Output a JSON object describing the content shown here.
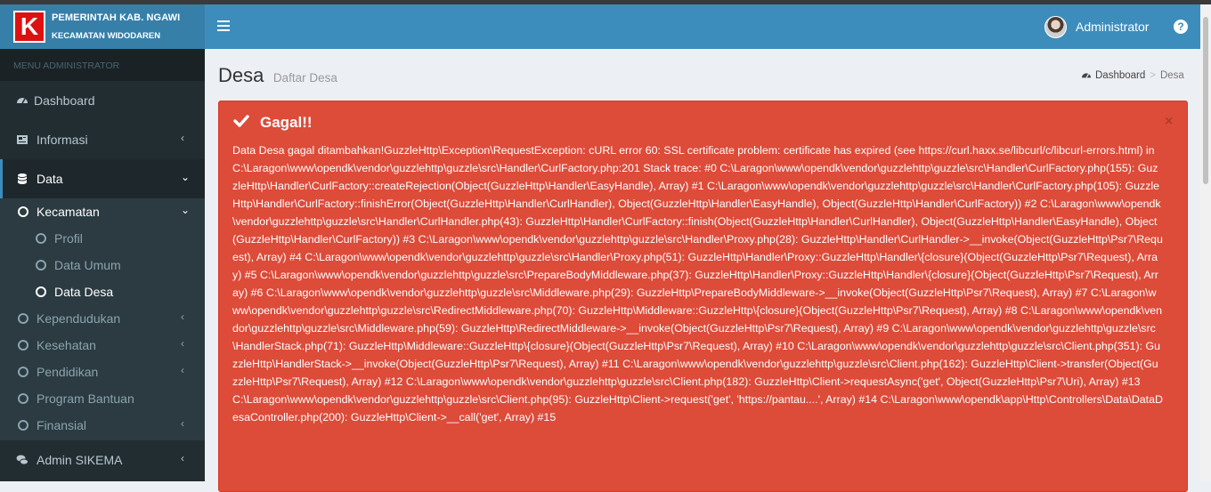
{
  "app": {
    "logo_letter": "K",
    "org_line1": "PEMERINTAH KAB. NGAWI",
    "org_line2": "KECAMATAN WIDODAREN"
  },
  "navbar": {
    "user_name": "Administrator",
    "help_icon": "question-circle-icon",
    "menu_icon": "hamburger-icon"
  },
  "sidebar": {
    "header": "MENU ADMINISTRATOR",
    "items": [
      {
        "label": "Dashboard",
        "icon": "dashboard-icon"
      },
      {
        "label": "Informasi",
        "icon": "newspaper-icon"
      },
      {
        "label": "Data",
        "icon": "database-icon"
      },
      {
        "label": "Admin SIKEMA",
        "icon": "comments-icon"
      }
    ],
    "data_submenu": [
      {
        "label": "Kecamatan"
      },
      {
        "label": "Profil"
      },
      {
        "label": "Data Umum"
      },
      {
        "label": "Data Desa"
      },
      {
        "label": "Kependudukan"
      },
      {
        "label": "Kesehatan"
      },
      {
        "label": "Pendidikan"
      },
      {
        "label": "Program Bantuan"
      },
      {
        "label": "Finansial"
      }
    ]
  },
  "page": {
    "title": "Desa",
    "subtitle": "Daftar Desa"
  },
  "breadcrumb": {
    "home": "Dashboard",
    "separator": ">",
    "current": "Desa"
  },
  "alert": {
    "title": "Gagal!!",
    "close": "×",
    "message": "Data Desa gagal ditambahkan!GuzzleHttp\\Exception\\RequestException: cURL error 60: SSL certificate problem: certificate has expired (see https://curl.haxx.se/libcurl/c/libcurl-errors.html) in C:\\Laragon\\www\\opendk\\vendor\\guzzlehttp\\guzzle\\src\\Handler\\CurlFactory.php:201 Stack trace: #0 C:\\Laragon\\www\\opendk\\vendor\\guzzlehttp\\guzzle\\src\\Handler\\CurlFactory.php(155): GuzzleHttp\\Handler\\CurlFactory::createRejection(Object(GuzzleHttp\\Handler\\EasyHandle), Array) #1 C:\\Laragon\\www\\opendk\\vendor\\guzzlehttp\\guzzle\\src\\Handler\\CurlFactory.php(105): GuzzleHttp\\Handler\\CurlFactory::finishError(Object(GuzzleHttp\\Handler\\CurlHandler), Object(GuzzleHttp\\Handler\\EasyHandle), Object(GuzzleHttp\\Handler\\CurlFactory)) #2 C:\\Laragon\\www\\opendk\\vendor\\guzzlehttp\\guzzle\\src\\Handler\\CurlHandler.php(43): GuzzleHttp\\Handler\\CurlFactory::finish(Object(GuzzleHttp\\Handler\\CurlHandler), Object(GuzzleHttp\\Handler\\EasyHandle), Object(GuzzleHttp\\Handler\\CurlFactory)) #3 C:\\Laragon\\www\\opendk\\vendor\\guzzlehttp\\guzzle\\src\\Handler\\Proxy.php(28): GuzzleHttp\\Handler\\CurlHandler->__invoke(Object(GuzzleHttp\\Psr7\\Request), Array) #4 C:\\Laragon\\www\\opendk\\vendor\\guzzlehttp\\guzzle\\src\\Handler\\Proxy.php(51): GuzzleHttp\\Handler\\Proxy::GuzzleHttp\\Handler\\{closure}(Object(GuzzleHttp\\Psr7\\Request), Array) #5 C:\\Laragon\\www\\opendk\\vendor\\guzzlehttp\\guzzle\\src\\PrepareBodyMiddleware.php(37): GuzzleHttp\\Handler\\Proxy::GuzzleHttp\\Handler\\{closure}(Object(GuzzleHttp\\Psr7\\Request), Array) #6 C:\\Laragon\\www\\opendk\\vendor\\guzzlehttp\\guzzle\\src\\Middleware.php(29): GuzzleHttp\\PrepareBodyMiddleware->__invoke(Object(GuzzleHttp\\Psr7\\Request), Array) #7 C:\\Laragon\\www\\opendk\\vendor\\guzzlehttp\\guzzle\\src\\RedirectMiddleware.php(70): GuzzleHttp\\Middleware::GuzzleHttp\\{closure}(Object(GuzzleHttp\\Psr7\\Request), Array) #8 C:\\Laragon\\www\\opendk\\vendor\\guzzlehttp\\guzzle\\src\\Middleware.php(59): GuzzleHttp\\RedirectMiddleware->__invoke(Object(GuzzleHttp\\Psr7\\Request), Array) #9 C:\\Laragon\\www\\opendk\\vendor\\guzzlehttp\\guzzle\\src\\HandlerStack.php(71): GuzzleHttp\\Middleware::GuzzleHttp\\{closure}(Object(GuzzleHttp\\Psr7\\Request), Array) #10 C:\\Laragon\\www\\opendk\\vendor\\guzzlehttp\\guzzle\\src\\Client.php(351): GuzzleHttp\\HandlerStack->__invoke(Object(GuzzleHttp\\Psr7\\Request), Array) #11 C:\\Laragon\\www\\opendk\\vendor\\guzzlehttp\\guzzle\\src\\Client.php(162): GuzzleHttp\\Client->transfer(Object(GuzzleHttp\\Psr7\\Request), Array) #12 C:\\Laragon\\www\\opendk\\vendor\\guzzlehttp\\guzzle\\src\\Client.php(182): GuzzleHttp\\Client->requestAsync('get', Object(GuzzleHttp\\Psr7\\Uri), Array) #13 C:\\Laragon\\www\\opendk\\vendor\\guzzlehttp\\guzzle\\src\\Client.php(95): GuzzleHttp\\Client->request('get', 'https://pantau....', Array) #14 C:\\Laragon\\www\\opendk\\app\\Http\\Controllers\\Data\\DataDesaController.php(200): GuzzleHttp\\Client->__call('get', Array) #15"
  },
  "colors": {
    "navbar": "#3c8dbc",
    "logo_bg": "#367fa9",
    "sidebar": "#222d32",
    "alert_danger": "#dd4b39"
  }
}
